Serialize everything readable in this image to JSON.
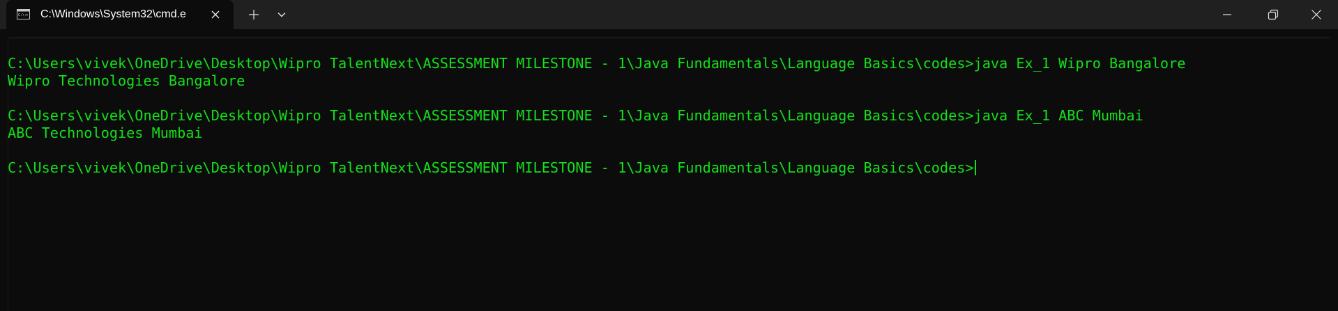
{
  "window": {
    "tab_title": "C:\\Windows\\System32\\cmd.e",
    "icons": {
      "tab": "terminal-icon",
      "tab_close": "close-icon",
      "new_tab": "plus-icon",
      "dropdown": "chevron-down-icon",
      "minimize": "minimize-icon",
      "maximize": "restore-icon",
      "close": "close-icon"
    }
  },
  "console": {
    "text_color": "#13e01a",
    "background": "#0c0c0c",
    "lines": [
      "C:\\Users\\vivek\\OneDrive\\Desktop\\Wipro TalentNext\\ASSESSMENT MILESTONE - 1\\Java Fundamentals\\Language Basics\\codes>java Ex_1 Wipro Bangalore",
      "Wipro Technologies Bangalore",
      "",
      "C:\\Users\\vivek\\OneDrive\\Desktop\\Wipro TalentNext\\ASSESSMENT MILESTONE - 1\\Java Fundamentals\\Language Basics\\codes>java Ex_1 ABC Mumbai",
      "ABC Technologies Mumbai",
      "",
      "C:\\Users\\vivek\\OneDrive\\Desktop\\Wipro TalentNext\\ASSESSMENT MILESTONE - 1\\Java Fundamentals\\Language Basics\\codes>"
    ]
  }
}
